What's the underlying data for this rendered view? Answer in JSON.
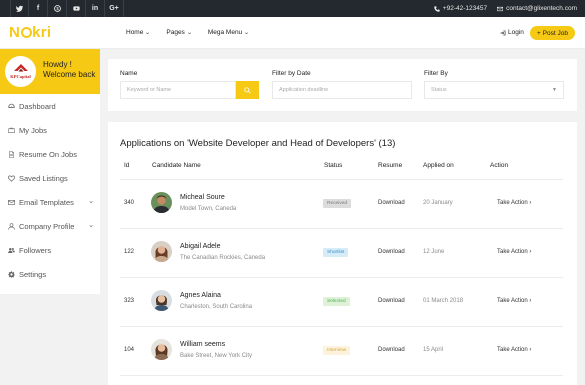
{
  "topbar": {
    "socials": [
      {
        "icon": "twitter-icon",
        "glyph": "t"
      },
      {
        "icon": "facebook-icon",
        "glyph": "f"
      },
      {
        "icon": "skype-icon",
        "glyph": "s"
      },
      {
        "icon": "youtube-icon",
        "glyph": "▶"
      },
      {
        "icon": "linkedin-icon",
        "glyph": "in"
      },
      {
        "icon": "google-plus-icon",
        "glyph": "G+"
      }
    ],
    "phone": "+92-42-123457",
    "email": "contact@glixentech.com"
  },
  "nav": {
    "logo": {
      "pre": "N",
      "post": "kri"
    },
    "menu": [
      {
        "label": "Home"
      },
      {
        "label": "Pages"
      },
      {
        "label": "Mega Menu"
      }
    ],
    "login": "Login",
    "post_job": "+ Post Job"
  },
  "sidebar": {
    "company_logo_text": "KPCapital",
    "greeting": "Howdy !",
    "welcome": "Welcome back",
    "items": [
      {
        "label": "Dashboard",
        "icon": "dashboard-icon",
        "has_arrow": false
      },
      {
        "label": "My Jobs",
        "icon": "briefcase-icon",
        "has_arrow": false
      },
      {
        "label": "Resume On Jobs",
        "icon": "document-icon",
        "has_arrow": false
      },
      {
        "label": "Saved Listings",
        "icon": "heart-icon",
        "has_arrow": false
      },
      {
        "label": "Email Templates",
        "icon": "envelope-icon",
        "has_arrow": true
      },
      {
        "label": "Company Profile",
        "icon": "user-icon",
        "has_arrow": true
      },
      {
        "label": "Followers",
        "icon": "followers-icon",
        "has_arrow": false
      },
      {
        "label": "Settings",
        "icon": "gear-icon",
        "has_arrow": false
      }
    ]
  },
  "filters": {
    "name_label": "Name",
    "name_placeholder": "Keyword or Name",
    "date_label": "Filter by Date",
    "date_placeholder": "Application deadline",
    "filter_label": "Filter By",
    "filter_value": "Status"
  },
  "applications": {
    "title": "Applications on 'Website Developer and Head of Developers' (13)",
    "columns": {
      "id": "Id",
      "candidate": "Candidate Name",
      "status": "Status",
      "resume": "Resume",
      "applied": "Applied on",
      "action": "Action"
    },
    "rows": [
      {
        "id": "340",
        "name": "Micheal Soure",
        "location": "Model Town, Caneda",
        "status": "Received",
        "status_bg": "#dcdcdc",
        "status_fg": "#777777",
        "resume": "Download",
        "applied": "20 January",
        "action": "Take Action"
      },
      {
        "id": "122",
        "name": "Abigail Adele",
        "location": "The Canadian Rockies, Caneda",
        "status": "Shortlist",
        "status_bg": "#d6ecf8",
        "status_fg": "#3a8fc4",
        "resume": "Download",
        "applied": "12 June",
        "action": "Take Action"
      },
      {
        "id": "323",
        "name": "Agnes Alaina",
        "location": "Charleston, South Carolina",
        "status": "Selected",
        "status_bg": "#dff2d8",
        "status_fg": "#4caf50",
        "resume": "Download",
        "applied": "01 March 2018",
        "action": "Take Action"
      },
      {
        "id": "104",
        "name": "William seems",
        "location": "Bake Street, New York City",
        "status": "Interview",
        "status_bg": "#fdf3dc",
        "status_fg": "#d9a43b",
        "resume": "Download",
        "applied": "15 April",
        "action": "Take Action"
      }
    ]
  },
  "colors": {
    "accent": "#f6c915",
    "topbar": "#24292f"
  }
}
